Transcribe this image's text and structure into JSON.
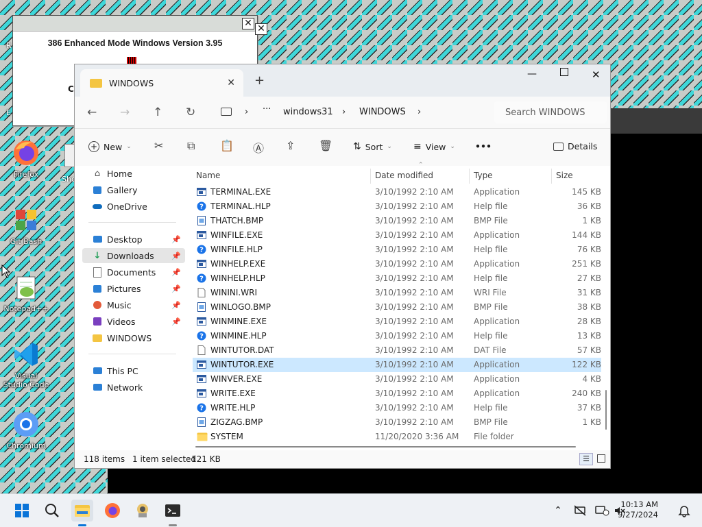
{
  "desktop": {
    "icons": [
      {
        "label": "Firefox"
      },
      {
        "label": "Git Bash"
      },
      {
        "label": "Notepad++"
      },
      {
        "label": "Visual Studio Code"
      },
      {
        "label": "Chromium"
      }
    ],
    "partial_labels": {
      "left_r": "R",
      "left_e": "E",
      "show": "Sho",
      "c": "C"
    }
  },
  "win31_dialog": {
    "message": "386 Enhanced Mode Windows Version 3.95",
    "close_glyph": "✕"
  },
  "explorer": {
    "tab_title": "WINDOWS",
    "breadcrumb": [
      "windows31",
      "WINDOWS"
    ],
    "search_placeholder": "Search WINDOWS",
    "toolbar": {
      "new_label": "New",
      "sort_label": "Sort",
      "view_label": "View",
      "more_label": "•••",
      "details_label": "Details"
    },
    "nav": {
      "top": [
        {
          "label": "Home",
          "icon": "home-icon"
        },
        {
          "label": "Gallery",
          "icon": "gallery-icon"
        },
        {
          "label": "OneDrive",
          "icon": "onedrive-icon"
        }
      ],
      "quick": [
        {
          "label": "Desktop",
          "icon": "desktop-icon",
          "pinned": true
        },
        {
          "label": "Downloads",
          "icon": "downloads-icon",
          "pinned": true,
          "selected": true
        },
        {
          "label": "Documents",
          "icon": "documents-icon",
          "pinned": true
        },
        {
          "label": "Pictures",
          "icon": "pictures-icon",
          "pinned": true
        },
        {
          "label": "Music",
          "icon": "music-icon",
          "pinned": true
        },
        {
          "label": "Videos",
          "icon": "videos-icon",
          "pinned": true
        },
        {
          "label": "WINDOWS",
          "icon": "folder-icon",
          "pinned": false
        }
      ],
      "bottom": [
        {
          "label": "This PC",
          "icon": "this-pc-icon"
        },
        {
          "label": "Network",
          "icon": "network-icon"
        }
      ]
    },
    "columns": {
      "name": "Name",
      "date": "Date modified",
      "type": "Type",
      "size": "Size"
    },
    "files": [
      {
        "name": "TERMINAL.EXE",
        "date": "3/10/1992 2:10 AM",
        "type": "Application",
        "size": "145 KB",
        "kind": "exe"
      },
      {
        "name": "TERMINAL.HLP",
        "date": "3/10/1992 2:10 AM",
        "type": "Help file",
        "size": "36 KB",
        "kind": "hlp"
      },
      {
        "name": "THATCH.BMP",
        "date": "3/10/1992 2:10 AM",
        "type": "BMP File",
        "size": "1 KB",
        "kind": "bmp"
      },
      {
        "name": "WINFILE.EXE",
        "date": "3/10/1992 2:10 AM",
        "type": "Application",
        "size": "144 KB",
        "kind": "exe"
      },
      {
        "name": "WINFILE.HLP",
        "date": "3/10/1992 2:10 AM",
        "type": "Help file",
        "size": "76 KB",
        "kind": "hlp"
      },
      {
        "name": "WINHELP.EXE",
        "date": "3/10/1992 2:10 AM",
        "type": "Application",
        "size": "251 KB",
        "kind": "exe"
      },
      {
        "name": "WINHELP.HLP",
        "date": "3/10/1992 2:10 AM",
        "type": "Help file",
        "size": "27 KB",
        "kind": "hlp"
      },
      {
        "name": "WININI.WRI",
        "date": "3/10/1992 2:10 AM",
        "type": "WRI File",
        "size": "31 KB",
        "kind": "doc"
      },
      {
        "name": "WINLOGO.BMP",
        "date": "3/10/1992 2:10 AM",
        "type": "BMP File",
        "size": "38 KB",
        "kind": "bmp"
      },
      {
        "name": "WINMINE.EXE",
        "date": "3/10/1992 2:10 AM",
        "type": "Application",
        "size": "28 KB",
        "kind": "exe"
      },
      {
        "name": "WINMINE.HLP",
        "date": "3/10/1992 2:10 AM",
        "type": "Help file",
        "size": "13 KB",
        "kind": "hlp"
      },
      {
        "name": "WINTUTOR.DAT",
        "date": "3/10/1992 2:10 AM",
        "type": "DAT File",
        "size": "57 KB",
        "kind": "doc"
      },
      {
        "name": "WINTUTOR.EXE",
        "date": "3/10/1992 2:10 AM",
        "type": "Application",
        "size": "122 KB",
        "kind": "exe",
        "selected": true
      },
      {
        "name": "WINVER.EXE",
        "date": "3/10/1992 2:10 AM",
        "type": "Application",
        "size": "4 KB",
        "kind": "exe"
      },
      {
        "name": "WRITE.EXE",
        "date": "3/10/1992 2:10 AM",
        "type": "Application",
        "size": "240 KB",
        "kind": "exe"
      },
      {
        "name": "WRITE.HLP",
        "date": "3/10/1992 2:10 AM",
        "type": "Help file",
        "size": "37 KB",
        "kind": "hlp"
      },
      {
        "name": "ZIGZAG.BMP",
        "date": "3/10/1992 2:10 AM",
        "type": "BMP File",
        "size": "1 KB",
        "kind": "bmp"
      },
      {
        "name": "SYSTEM",
        "date": "11/20/2020 3:36 AM",
        "type": "File folder",
        "size": "",
        "kind": "folder"
      }
    ],
    "status": {
      "count": "118 items",
      "selection": "1 item selected",
      "selection_size": "121 KB"
    }
  },
  "taskbar": {
    "time": "10:13 AM",
    "date": "9/27/2024"
  },
  "colors": {
    "accent": "#0067c0",
    "selected_row": "#cce8ff",
    "folder": "#f4c542"
  }
}
